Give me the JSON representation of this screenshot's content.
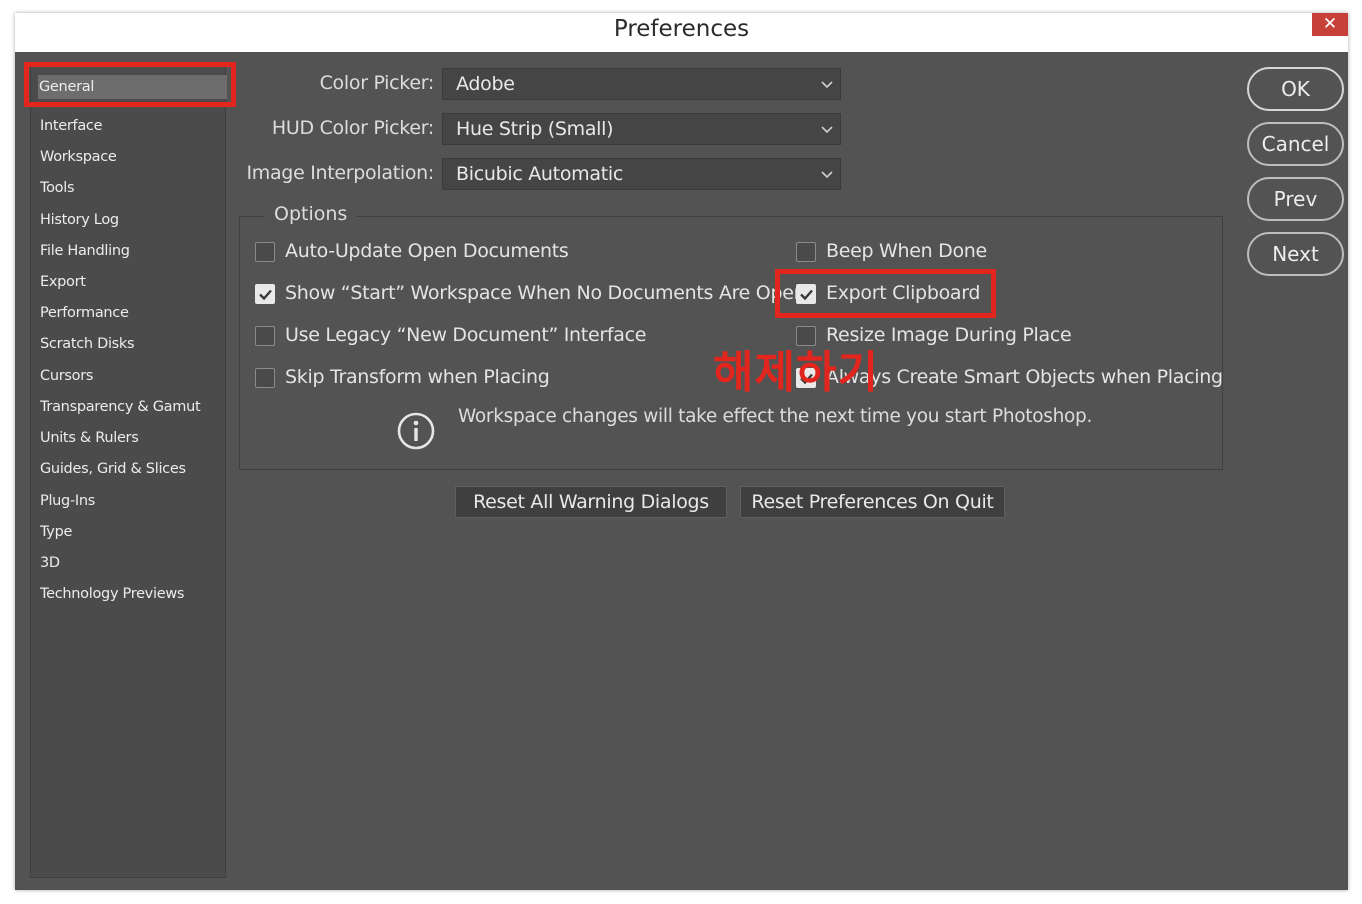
{
  "window": {
    "title": "Preferences",
    "close_label": "✕"
  },
  "sidebar": {
    "items": [
      {
        "label": "General",
        "active": true
      },
      {
        "label": "Interface"
      },
      {
        "label": "Workspace"
      },
      {
        "label": "Tools"
      },
      {
        "label": "History Log"
      },
      {
        "label": "File Handling"
      },
      {
        "label": "Export"
      },
      {
        "label": "Performance"
      },
      {
        "label": "Scratch Disks"
      },
      {
        "label": "Cursors"
      },
      {
        "label": "Transparency & Gamut"
      },
      {
        "label": "Units & Rulers"
      },
      {
        "label": "Guides, Grid & Slices"
      },
      {
        "label": "Plug-Ins"
      },
      {
        "label": "Type"
      },
      {
        "label": "3D"
      },
      {
        "label": "Technology Previews"
      }
    ]
  },
  "fields": {
    "color_picker": {
      "label": "Color Picker:",
      "value": "Adobe"
    },
    "hud_color_picker": {
      "label": "HUD Color Picker:",
      "value": "Hue Strip (Small)"
    },
    "image_interpolation": {
      "label": "Image Interpolation:",
      "value": "Bicubic Automatic"
    }
  },
  "options": {
    "legend": "Options",
    "auto_update": {
      "label": "Auto-Update Open Documents",
      "checked": false
    },
    "show_start": {
      "label": "Show “Start” Workspace When No Documents Are Open",
      "checked": true
    },
    "legacy_new_doc": {
      "label": "Use Legacy “New Document” Interface",
      "checked": false
    },
    "skip_transform": {
      "label": "Skip Transform when Placing",
      "checked": false
    },
    "beep_when_done": {
      "label": "Beep When Done",
      "checked": false
    },
    "export_clipboard": {
      "label": "Export Clipboard",
      "checked": true
    },
    "resize_image": {
      "label": "Resize Image During Place",
      "checked": false
    },
    "smart_objects": {
      "label": "Always Create Smart Objects when Placing",
      "checked": true
    },
    "info_text": "Workspace changes will take effect the next time you start Photoshop."
  },
  "buttons": {
    "reset_warnings": "Reset All Warning Dialogs",
    "reset_prefs": "Reset Preferences On Quit",
    "ok": "OK",
    "cancel": "Cancel",
    "prev": "Prev",
    "next": "Next"
  },
  "annotation": {
    "text": "해제하기",
    "color": "#e3261d"
  },
  "icons": {
    "chevron": "chevron-down-icon",
    "check": "check-icon",
    "info": "info-icon"
  }
}
